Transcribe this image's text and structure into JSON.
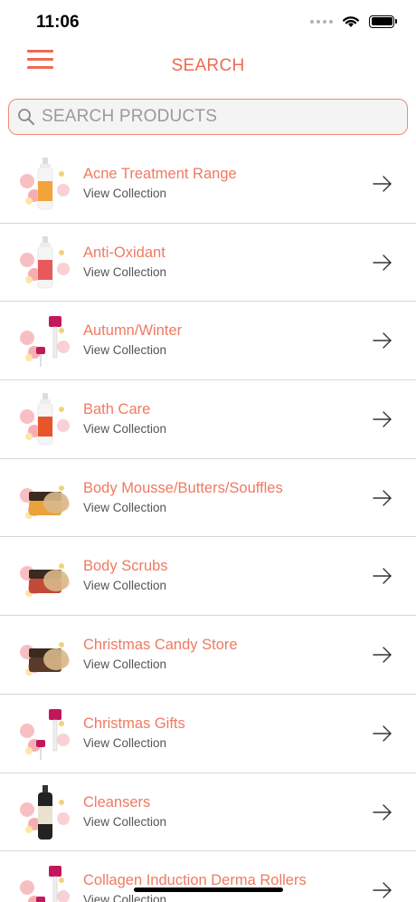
{
  "status": {
    "time": "11:06"
  },
  "header": {
    "title": "SEARCH"
  },
  "search": {
    "placeholder": "SEARCH PRODUCTS"
  },
  "colors": {
    "accent": "#ef6a52",
    "title": "#ef7a62",
    "subtitle": "#555555",
    "divider": "#d6d6d6"
  },
  "items": [
    {
      "title": "Acne Treatment Range",
      "subtitle": "View Collection",
      "thumb": "spray-bottle",
      "product": "#f3a33a"
    },
    {
      "title": "Anti-Oxidant",
      "subtitle": "View Collection",
      "thumb": "spray-bottle",
      "product": "#e85a5a"
    },
    {
      "title": "Autumn/Winter",
      "subtitle": "View Collection",
      "thumb": "derma-roller",
      "product": "#c2185b"
    },
    {
      "title": "Bath Care",
      "subtitle": "View Collection",
      "thumb": "bottle",
      "product": "#e8552b"
    },
    {
      "title": "Body Mousse/Butters/Souffles",
      "subtitle": "View Collection",
      "thumb": "jar",
      "product": "#e8a33a"
    },
    {
      "title": "Body Scrubs",
      "subtitle": "View Collection",
      "thumb": "jar",
      "product": "#c24a3a"
    },
    {
      "title": "Christmas Candy Store",
      "subtitle": "View Collection",
      "thumb": "jar",
      "product": "#5a3a2a"
    },
    {
      "title": "Christmas Gifts",
      "subtitle": "View Collection",
      "thumb": "derma-roller",
      "product": "#c2185b"
    },
    {
      "title": "Cleansers",
      "subtitle": "View Collection",
      "thumb": "dark-bottle",
      "product": "#222222"
    },
    {
      "title": "Collagen Induction Derma Rollers",
      "subtitle": "View Collection",
      "thumb": "derma-roller",
      "product": "#c2185b"
    }
  ]
}
